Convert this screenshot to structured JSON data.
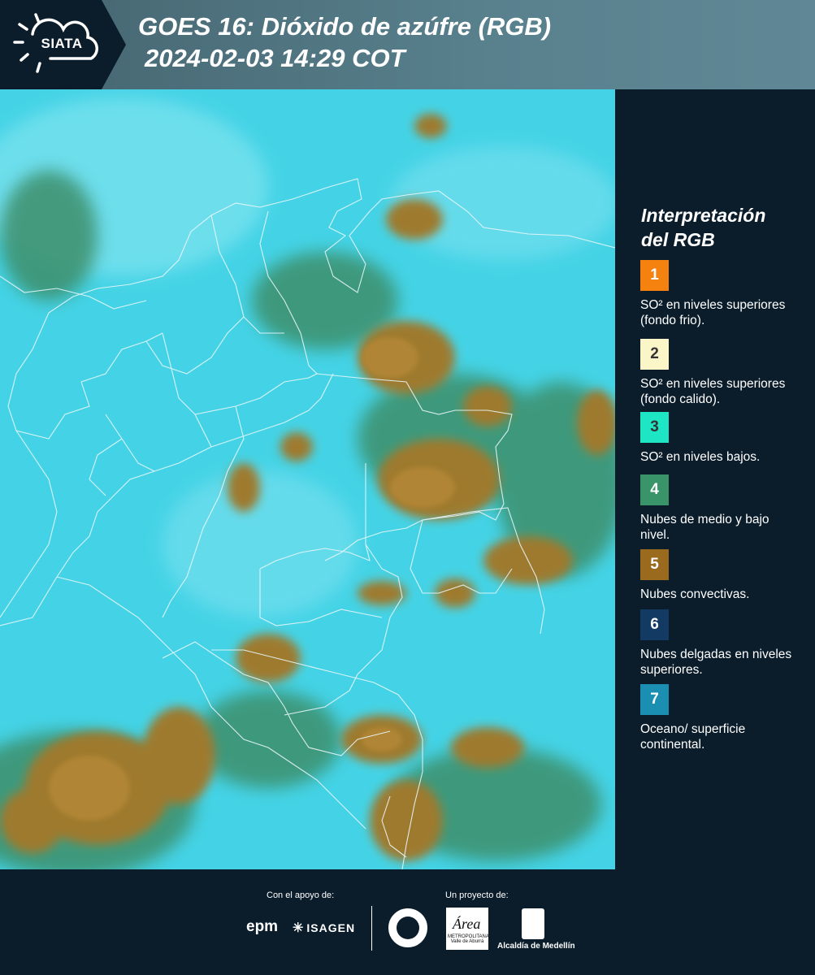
{
  "header": {
    "logo_text": "SIATA",
    "title_line1": "GOES 16: Dióxido de azúfre (RGB)",
    "title_line2": "2024-02-03 14:29 COT"
  },
  "legend": {
    "title_line1": "Interpretación",
    "title_line2": "del RGB",
    "items": [
      {
        "number": "1",
        "color": "#f5820f",
        "label": "SO² en niveles superiores (fondo frio)."
      },
      {
        "number": "2",
        "color": "#fbf6c8",
        "label": "SO² en niveles superiores (fondo calido)."
      },
      {
        "number": "3",
        "color": "#1ee5c4",
        "label": "SO² en niveles bajos."
      },
      {
        "number": "4",
        "color": "#3a9469",
        "label": "Nubes de medio y bajo nivel."
      },
      {
        "number": "5",
        "color": "#9a6b1e",
        "label": "Nubes convectivas."
      },
      {
        "number": "6",
        "color": "#123a63",
        "label": "Nubes delgadas en niveles superiores."
      },
      {
        "number": "7",
        "color": "#1b8fb2",
        "label": "Oceano/ superficie continental."
      }
    ]
  },
  "footer": {
    "support_label": "Con el apoyo de:",
    "project_label": "Un proyecto de:",
    "epm_label": "epm",
    "isagen_label": "ISAGEN",
    "area_label": "Área",
    "area_sub": "METROPOLITANA Valle de Aburrá",
    "alcaldia_label": "Alcaldía de Medellín"
  },
  "colors": {
    "background": "#0b1d2b",
    "header_gradient_start": "#44646f",
    "header_gradient_end": "#5f8795",
    "map_surface": "#3fd4e6",
    "convective": "#a0782a",
    "midlevel": "#3d8f68"
  }
}
